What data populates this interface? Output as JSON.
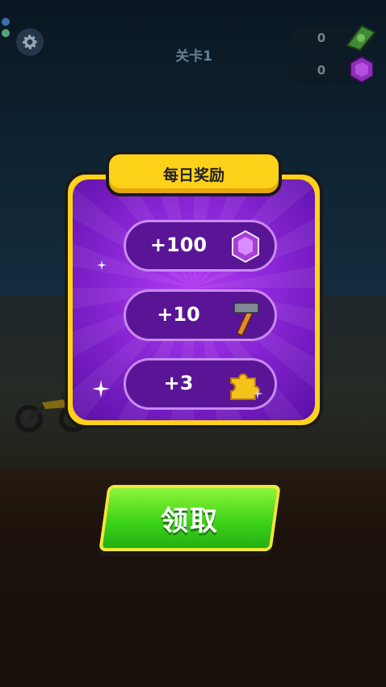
{
  "hud": {
    "level_label": "关卡1",
    "cash_count": "0",
    "gem_count": "0"
  },
  "dialog": {
    "title": "每日奖励",
    "rewards": [
      {
        "amount": "+100",
        "icon": "gem-icon"
      },
      {
        "amount": "+10",
        "icon": "hammer-icon"
      },
      {
        "amount": "+3",
        "icon": "puzzle-piece-icon"
      }
    ],
    "claim_label": "领取"
  },
  "colors": {
    "panel_purple": "#8a26d6",
    "panel_border": "#ffd21a",
    "claim_green": "#3fd41a"
  }
}
